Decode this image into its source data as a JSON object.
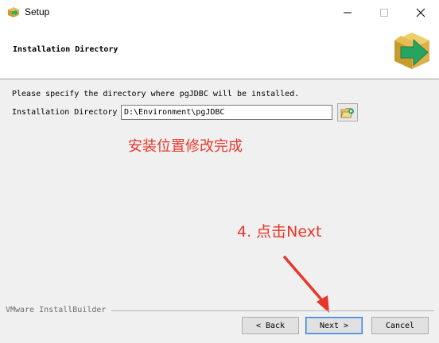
{
  "window": {
    "title": "Setup"
  },
  "header": {
    "title": "Installation Directory"
  },
  "main": {
    "description": "Please specify the directory where pgJDBC will be installed.",
    "dir_label": "Installation Directory",
    "dir_value": "D:\\Environment\\pgJDBC"
  },
  "annotations": {
    "note1": "安装位置修改完成",
    "note2": "4. 点击Next",
    "color": "#e8362b"
  },
  "footer": {
    "brand": "VMware InstallBuilder",
    "back_label": "< Back",
    "next_label": "Next >",
    "cancel_label": "Cancel"
  },
  "icons": {
    "app": "installer-box-icon",
    "header": "installer-box-arrow-icon",
    "browse": "folder-browse-icon"
  }
}
